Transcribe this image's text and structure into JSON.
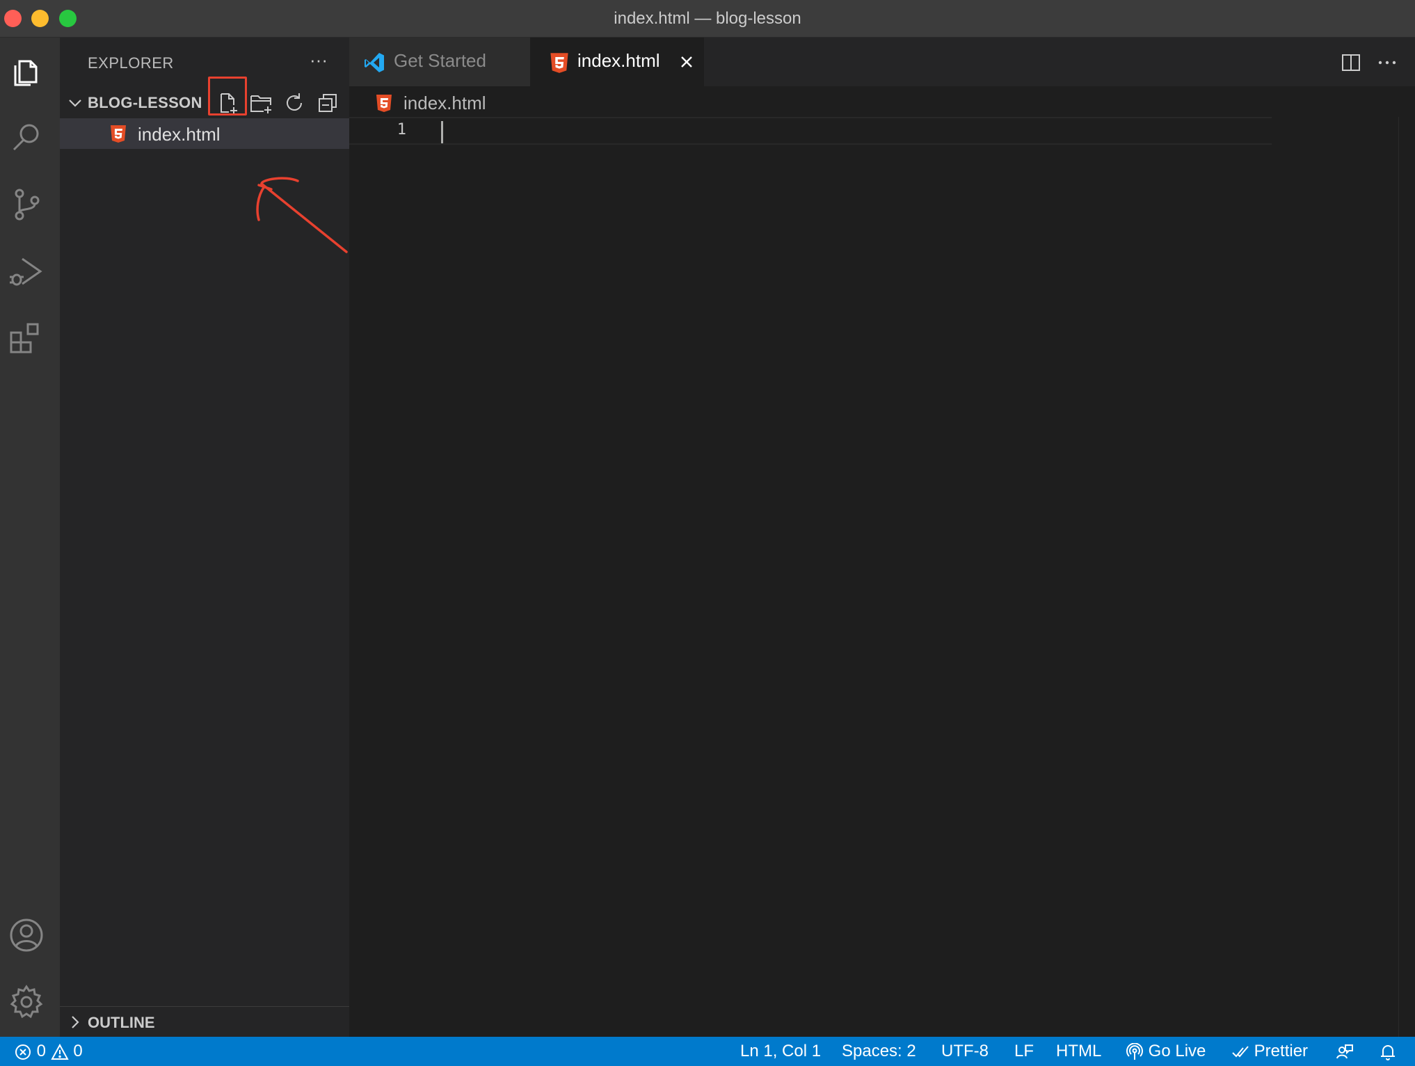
{
  "window": {
    "title": "index.html — blog-lesson"
  },
  "activity_bar": {
    "items": [
      "explorer-icon",
      "search-icon",
      "source-control-icon",
      "run-debug-icon",
      "extensions-icon"
    ],
    "bottom_items": [
      "account-icon",
      "settings-gear-icon"
    ]
  },
  "sidebar": {
    "title": "EXPLORER",
    "more_label": "···",
    "folder": {
      "name": "BLOG-LESSON",
      "actions": [
        "new-file-icon",
        "new-folder-icon",
        "refresh-icon",
        "collapse-all-icon"
      ]
    },
    "files": [
      {
        "name": "index.html",
        "icon": "html5-icon"
      }
    ],
    "outline_label": "OUTLINE"
  },
  "tabs": [
    {
      "label": "Get Started",
      "icon": "vscode-logo-icon",
      "active": false
    },
    {
      "label": "index.html",
      "icon": "html5-icon",
      "active": true
    }
  ],
  "breadcrumb": {
    "file": "index.html"
  },
  "editor": {
    "line_number": "1",
    "content": ""
  },
  "statusbar": {
    "errors": "0",
    "warnings": "0",
    "position": "Ln 1, Col 1",
    "spaces": "Spaces: 2",
    "encoding": "UTF-8",
    "eol": "LF",
    "language": "HTML",
    "go_live": "Go Live",
    "prettier": "Prettier"
  },
  "colors": {
    "accent": "#007acc",
    "annotation": "#e8412f",
    "html_icon": "#e44d26"
  }
}
